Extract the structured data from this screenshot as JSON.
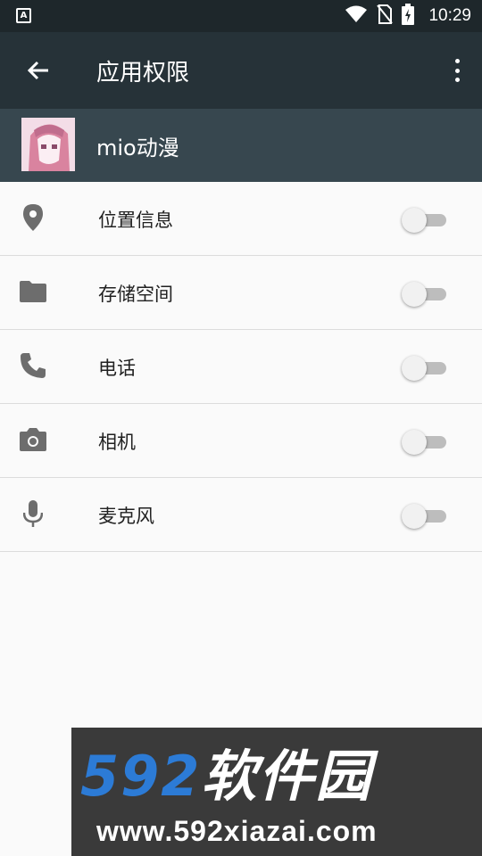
{
  "status_bar": {
    "left_icon": "A",
    "time": "10:29",
    "icons": [
      "wifi-icon",
      "no-sim-icon",
      "battery-charging-icon"
    ]
  },
  "toolbar": {
    "title": "应用权限",
    "back_icon": "arrow-back-icon",
    "more_icon": "more-vert-icon"
  },
  "app": {
    "name": "mio动漫"
  },
  "permissions": [
    {
      "label": "位置信息",
      "icon": "location-icon",
      "enabled": false
    },
    {
      "label": "存储空间",
      "icon": "folder-icon",
      "enabled": false
    },
    {
      "label": "电话",
      "icon": "phone-icon",
      "enabled": false
    },
    {
      "label": "相机",
      "icon": "camera-icon",
      "enabled": false
    },
    {
      "label": "麦克风",
      "icon": "microphone-icon",
      "enabled": false
    }
  ],
  "watermark": {
    "number": "592",
    "brand": "软件园",
    "url": "www.592xiazai.com"
  },
  "colors": {
    "toolbar": "#263238",
    "statusbar": "#1e272b",
    "app_header": "#37474f",
    "icon_gray": "#6d6d6d",
    "switch_track_off": "#bdbdbd",
    "switch_thumb_off": "#f1f1f1"
  }
}
